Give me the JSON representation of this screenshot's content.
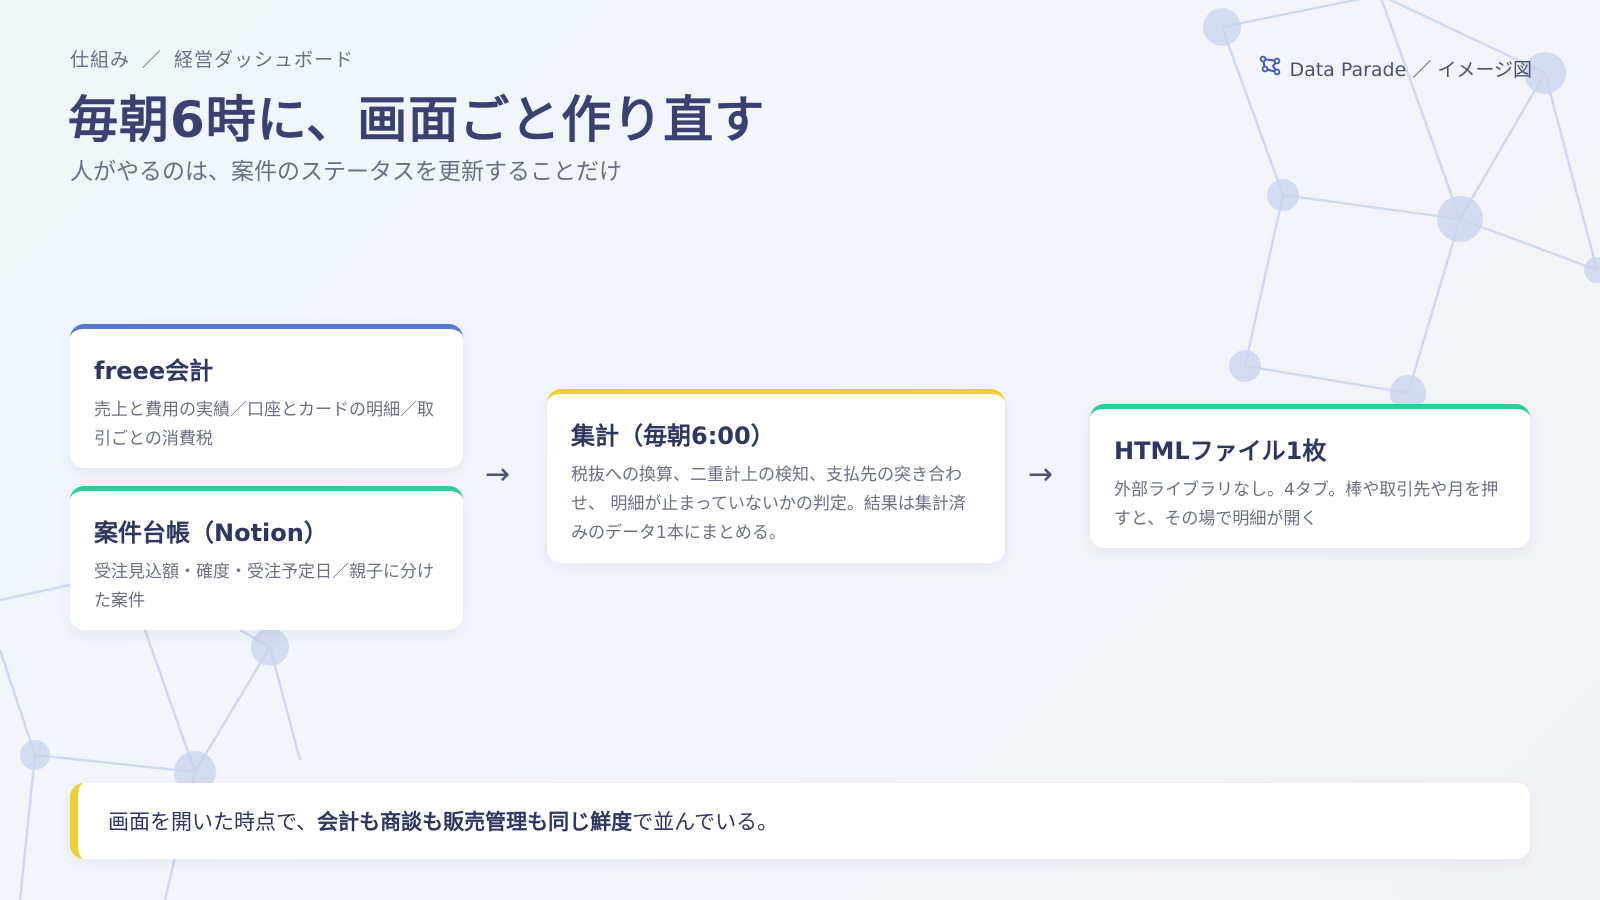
{
  "header": {
    "breadcrumb": [
      "仕組み",
      "／",
      "経営ダッシュボード"
    ],
    "title": "毎朝6時に、画面ごと作り直す",
    "subtitle": "人がやるのは、案件のステータスを更新することだけ"
  },
  "brand": {
    "icon": "network-icon",
    "label": "Data Parade ／ イメージ図"
  },
  "sources": [
    {
      "title": "freee会計",
      "description": "売上と費用の実績／口座とカードの明細／取引ごとの消費税",
      "accent": "#5b78d0"
    },
    {
      "title": "案件台帳（Notion）",
      "description": "受注見込額・確度・受注予定日／親子に分けた案件",
      "accent": "#2ecc9b"
    }
  ],
  "aggregation": {
    "title": "集計（毎朝6:00）",
    "description": "税抜への換算、二重計上の検知、支払先の突き合わせ、 明細が止まっていないかの判定。結果は集計済みのデータ1本にまとめる。",
    "accent": "#ecd032"
  },
  "output": {
    "title": "HTMLファイル1枚",
    "description": "外部ライブラリなし。4タブ。棒や取引先や月を押すと、その場で明細が開く",
    "accent": "#2ecc9b"
  },
  "arrows": [
    "→",
    "→"
  ],
  "note": {
    "before": "画面を開いた時点で、",
    "emphasis": "会計も商談も販売管理も同じ鮮度",
    "after": "で並んでいる。",
    "accent": "#ecd032"
  }
}
